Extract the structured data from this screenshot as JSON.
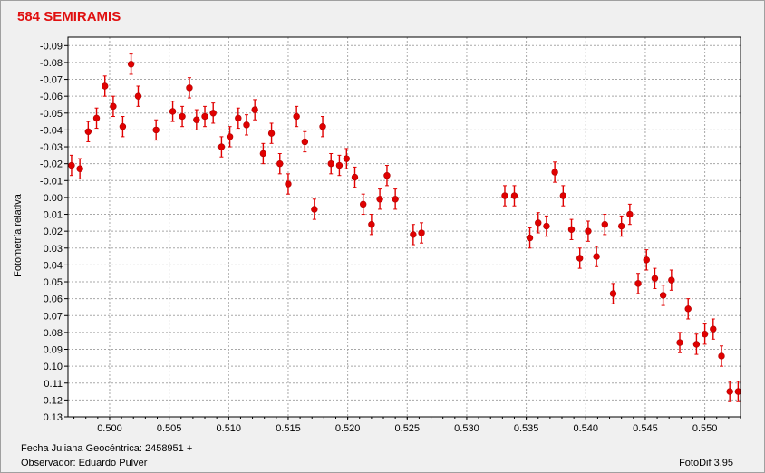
{
  "window": {
    "title": "584 SEMIRAMIS",
    "title_color": "#e01010"
  },
  "footer": {
    "jd_label": "Fecha Juliana Geocéntrica: 2458951 +",
    "observer_label": "Observador: Eduardo Pulver",
    "software": "FotoDif 3.95"
  },
  "chart_data": {
    "type": "scatter",
    "title": "584 SEMIRAMIS",
    "xlabel": "Fecha Juliana Geocéntrica: 2458951 +",
    "ylabel": "Fotometría relativa",
    "xlim": [
      0.4965,
      0.553
    ],
    "ylim": [
      -0.095,
      0.13
    ],
    "y_inverted": true,
    "grid": true,
    "marker_color": "#e00000",
    "x_ticks": [
      "0.500",
      "0.505",
      "0.510",
      "0.515",
      "0.520",
      "0.525",
      "0.530",
      "0.535",
      "0.540",
      "0.545",
      "0.550"
    ],
    "y_ticks": [
      "-0.09",
      "-0.08",
      "-0.07",
      "-0.06",
      "-0.05",
      "-0.04",
      "-0.03",
      "-0.02",
      "-0.01",
      "0.00",
      "0.01",
      "0.02",
      "0.03",
      "0.04",
      "0.05",
      "0.06",
      "0.07",
      "0.08",
      "0.09",
      "0.10",
      "0.11",
      "0.12",
      "0.13"
    ],
    "error": 0.006,
    "points": [
      {
        "x": 0.4968,
        "y": -0.019
      },
      {
        "x": 0.4975,
        "y": -0.017
      },
      {
        "x": 0.4982,
        "y": -0.039
      },
      {
        "x": 0.4989,
        "y": -0.047
      },
      {
        "x": 0.4996,
        "y": -0.066
      },
      {
        "x": 0.5003,
        "y": -0.054
      },
      {
        "x": 0.5011,
        "y": -0.042
      },
      {
        "x": 0.5018,
        "y": -0.079
      },
      {
        "x": 0.5024,
        "y": -0.06
      },
      {
        "x": 0.5039,
        "y": -0.04
      },
      {
        "x": 0.5053,
        "y": -0.051
      },
      {
        "x": 0.5061,
        "y": -0.048
      },
      {
        "x": 0.5067,
        "y": -0.065
      },
      {
        "x": 0.5073,
        "y": -0.046
      },
      {
        "x": 0.508,
        "y": -0.048
      },
      {
        "x": 0.5087,
        "y": -0.05
      },
      {
        "x": 0.5094,
        "y": -0.03
      },
      {
        "x": 0.5101,
        "y": -0.036
      },
      {
        "x": 0.5108,
        "y": -0.047
      },
      {
        "x": 0.5115,
        "y": -0.043
      },
      {
        "x": 0.5122,
        "y": -0.052
      },
      {
        "x": 0.5129,
        "y": -0.026
      },
      {
        "x": 0.5136,
        "y": -0.038
      },
      {
        "x": 0.5143,
        "y": -0.02
      },
      {
        "x": 0.515,
        "y": -0.008
      },
      {
        "x": 0.5157,
        "y": -0.048
      },
      {
        "x": 0.5164,
        "y": -0.033
      },
      {
        "x": 0.5172,
        "y": 0.007
      },
      {
        "x": 0.5179,
        "y": -0.042
      },
      {
        "x": 0.5186,
        "y": -0.02
      },
      {
        "x": 0.5193,
        "y": -0.019
      },
      {
        "x": 0.5199,
        "y": -0.023
      },
      {
        "x": 0.5206,
        "y": -0.012
      },
      {
        "x": 0.5213,
        "y": 0.004
      },
      {
        "x": 0.522,
        "y": 0.016
      },
      {
        "x": 0.5227,
        "y": 0.001
      },
      {
        "x": 0.5233,
        "y": -0.013
      },
      {
        "x": 0.524,
        "y": 0.001
      },
      {
        "x": 0.5255,
        "y": 0.022
      },
      {
        "x": 0.5262,
        "y": 0.021
      },
      {
        "x": 0.5332,
        "y": -0.001
      },
      {
        "x": 0.534,
        "y": -0.001
      },
      {
        "x": 0.5353,
        "y": 0.024
      },
      {
        "x": 0.536,
        "y": 0.015
      },
      {
        "x": 0.5367,
        "y": 0.017
      },
      {
        "x": 0.5374,
        "y": -0.015
      },
      {
        "x": 0.5381,
        "y": -0.001
      },
      {
        "x": 0.5388,
        "y": 0.019
      },
      {
        "x": 0.5395,
        "y": 0.036
      },
      {
        "x": 0.5402,
        "y": 0.02
      },
      {
        "x": 0.5409,
        "y": 0.035
      },
      {
        "x": 0.5416,
        "y": 0.016
      },
      {
        "x": 0.5423,
        "y": 0.057
      },
      {
        "x": 0.543,
        "y": 0.017
      },
      {
        "x": 0.5437,
        "y": 0.01
      },
      {
        "x": 0.5444,
        "y": 0.051
      },
      {
        "x": 0.5451,
        "y": 0.037
      },
      {
        "x": 0.5458,
        "y": 0.048
      },
      {
        "x": 0.5465,
        "y": 0.058
      },
      {
        "x": 0.5472,
        "y": 0.049
      },
      {
        "x": 0.5479,
        "y": 0.086
      },
      {
        "x": 0.5486,
        "y": 0.066
      },
      {
        "x": 0.5493,
        "y": 0.087
      },
      {
        "x": 0.55,
        "y": 0.081
      },
      {
        "x": 0.5507,
        "y": 0.078
      },
      {
        "x": 0.5514,
        "y": 0.094
      },
      {
        "x": 0.5521,
        "y": 0.115
      },
      {
        "x": 0.5528,
        "y": 0.115
      }
    ]
  }
}
